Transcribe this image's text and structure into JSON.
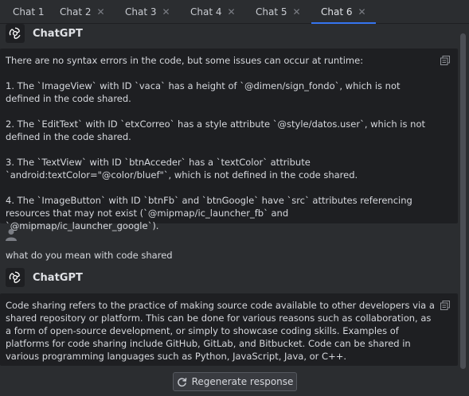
{
  "tabs": [
    {
      "label": "Chat 1",
      "closable": false
    },
    {
      "label": "Chat 2",
      "closable": true
    },
    {
      "label": "Chat 3",
      "closable": true
    },
    {
      "label": "Chat 4",
      "closable": true
    },
    {
      "label": "Chat 5",
      "closable": true
    },
    {
      "label": "Chat 6",
      "closable": true,
      "active": true
    }
  ],
  "assistant_name": "ChatGPT",
  "response1": {
    "intro": "There are no syntax errors in the code, but some issues can occur at runtime:",
    "items": [
      "1. The `ImageView` with ID `vaca` has a height of `@dimen/sign_fondo`, which is not defined in the code shared.",
      "2. The `EditText` with ID `etxCorreo` has a style attribute `@style/datos.user`, which is not defined in the code shared.",
      "3. The `TextView` with ID `btnAcceder` has a `textColor` attribute `android:textColor=\"@color/bluef\"`, which is not defined in the code shared.",
      "4. The `ImageButton` with ID `btnFb` and `btnGoogle` have `src` attributes referencing resources that may not exist (`@mipmap/ic_launcher_fb` and `@mipmap/ic_launcher_google`)."
    ]
  },
  "user_message": "what do you mean with code shared",
  "response2": {
    "text": "Code sharing refers to the practice of making source code available to other developers via a shared repository or platform. This can be done for various reasons such as collaboration, as a form of open-source development, or simply to showcase coding skills. Examples of platforms for code sharing include GitHub, GitLab, and Bitbucket. Code can be shared in various programming languages such as Python, JavaScript, Java, or C++."
  },
  "regenerate_label": "Regenerate response",
  "icons": {
    "close": "close-icon",
    "logo": "openai-logo-icon",
    "copy": "copy-icon",
    "user": "user-icon",
    "regenerate": "refresh-icon"
  },
  "colors": {
    "accent": "#3574f0",
    "background": "#2b2d30",
    "message_background": "#1e1f22",
    "number": "#e8a33d"
  }
}
